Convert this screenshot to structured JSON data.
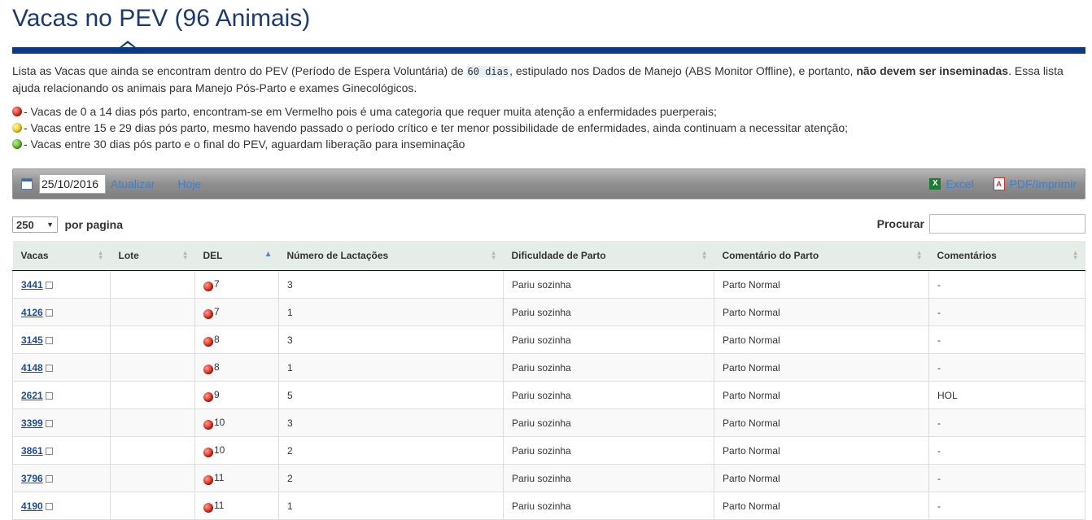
{
  "page": {
    "title": "Vacas no PEV (96 Animais)"
  },
  "description": {
    "part1": "Lista as Vacas que ainda se encontram dentro do PEV (Período de Espera Voluntária) de ",
    "days": "60 dias",
    "part2": ", estipulado nos Dados de Manejo (ABS Monitor Offline), e portanto, ",
    "bold": "não devem ser inseminadas",
    "part3": ". Essa lista ajuda relacionando os animais para Manejo Pós-Parto e exames Ginecológicos."
  },
  "legend": {
    "red": "- Vacas de 0 a 14 dias pós parto, encontram-se em Vermelho pois é uma categoria que requer muita atenção a enfermidades puerperais;",
    "yellow": "- Vacas entre 15 e 29 dias pós parto, mesmo havendo passado o período crítico e ter menor possibilidade de enfermidades, ainda continuam a necessitar atenção;",
    "green": "- Vacas entre 30 dias pós parto e o final do PEV, aguardam liberação para inseminação"
  },
  "toolbar": {
    "date_value": "25/10/2016",
    "atualizar": "Atualizar",
    "hoje": "Hoje",
    "excel": "Excel",
    "pdf": "PDF/Imprimir"
  },
  "controls": {
    "per_page_value": "250",
    "per_page_label": "por pagina",
    "search_label": "Procurar",
    "search_value": ""
  },
  "table": {
    "headers": [
      "Vacas",
      "Lote",
      "DEL",
      "Número de Lactações",
      "Dificuldade de Parto",
      "Comentário do Parto",
      "Comentários"
    ],
    "rows": [
      {
        "vaca": "3441",
        "lote": "",
        "del": "7",
        "lact": "3",
        "dif": "Pariu sozinha",
        "com_parto": "Parto Normal",
        "coment": "-"
      },
      {
        "vaca": "4126",
        "lote": "",
        "del": "7",
        "lact": "1",
        "dif": "Pariu sozinha",
        "com_parto": "Parto Normal",
        "coment": "-"
      },
      {
        "vaca": "3145",
        "lote": "",
        "del": "8",
        "lact": "3",
        "dif": "Pariu sozinha",
        "com_parto": "Parto Normal",
        "coment": "-"
      },
      {
        "vaca": "4148",
        "lote": "",
        "del": "8",
        "lact": "1",
        "dif": "Pariu sozinha",
        "com_parto": "Parto Normal",
        "coment": "-"
      },
      {
        "vaca": "2621",
        "lote": "",
        "del": "9",
        "lact": "5",
        "dif": "Pariu sozinha",
        "com_parto": "Parto Normal",
        "coment": "HOL"
      },
      {
        "vaca": "3399",
        "lote": "",
        "del": "10",
        "lact": "3",
        "dif": "Pariu sozinha",
        "com_parto": "Parto Normal",
        "coment": "-"
      },
      {
        "vaca": "3861",
        "lote": "",
        "del": "10",
        "lact": "2",
        "dif": "Pariu sozinha",
        "com_parto": "Parto Normal",
        "coment": "-"
      },
      {
        "vaca": "3796",
        "lote": "",
        "del": "11",
        "lact": "2",
        "dif": "Pariu sozinha",
        "com_parto": "Parto Normal",
        "coment": "-"
      },
      {
        "vaca": "4190",
        "lote": "",
        "del": "11",
        "lact": "1",
        "dif": "Pariu sozinha",
        "com_parto": "Parto Normal",
        "coment": "-"
      }
    ]
  },
  "colors": {
    "title": "#1d3a70",
    "title_bar": "#0a3a82",
    "link": "#3f80d0",
    "cow_link": "#1d4e95",
    "status_red": "#d8281a"
  },
  "icons": {
    "calendar": "calendar-icon",
    "excel": "excel-icon",
    "pdf": "pdf-icon",
    "external": "external-link-icon",
    "status": "red-status-dot-icon"
  }
}
